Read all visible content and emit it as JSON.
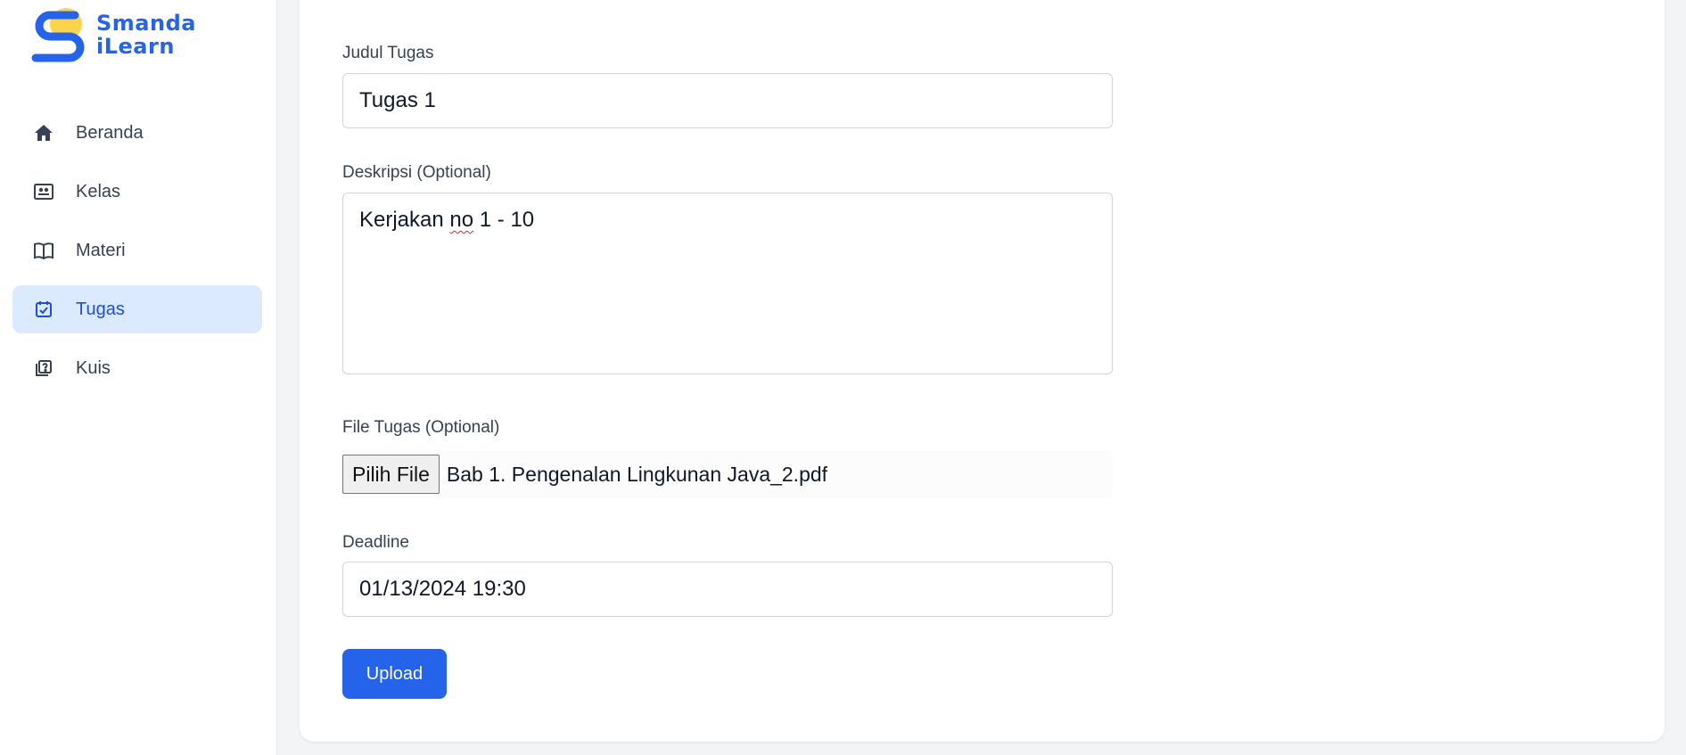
{
  "brand": {
    "line1": "Smanda",
    "line2": "iLearn",
    "accent": "#2563eb",
    "accent2": "#fcd34d"
  },
  "sidebar": {
    "items": [
      {
        "label": "Beranda",
        "icon": "home-icon",
        "active": false
      },
      {
        "label": "Kelas",
        "icon": "class-icon",
        "active": false
      },
      {
        "label": "Materi",
        "icon": "book-icon",
        "active": false
      },
      {
        "label": "Tugas",
        "icon": "task-check-icon",
        "active": true
      },
      {
        "label": "Kuis",
        "icon": "quiz-icon",
        "active": false
      }
    ]
  },
  "form": {
    "title_label": "Judul Tugas",
    "title_value": "Tugas 1",
    "desc_label": "Deskripsi (Optional)",
    "desc_value_pre": "Kerjakan ",
    "desc_value_misspelled": "no",
    "desc_value_post": " 1 - 10",
    "file_label": "File Tugas (Optional)",
    "file_button": "Pilih File",
    "file_name": "Bab 1. Pengenalan Lingkunan Java_2.pdf",
    "deadline_label": "Deadline",
    "deadline_value": "01/13/2024 19:30",
    "submit_label": "Upload"
  }
}
